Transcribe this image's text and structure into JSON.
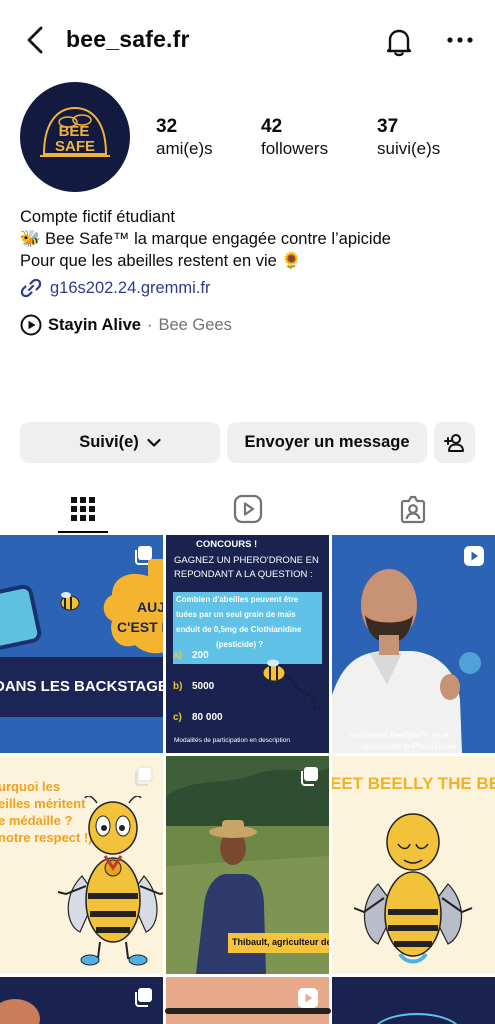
{
  "header": {
    "username": "bee_safe.fr",
    "back_icon": "chevron-left-icon",
    "bell_icon": "bell-icon",
    "more_icon": "more-horizontal-icon"
  },
  "profile": {
    "avatar_text_top": "BEE",
    "avatar_text_bottom": "SAFE",
    "stats": [
      {
        "value": "32",
        "label": "ami(e)s"
      },
      {
        "value": "42",
        "label": "followers"
      },
      {
        "value": "37",
        "label": "suivi(e)s"
      }
    ],
    "bio": [
      "Compte fictif étudiant",
      "🐝 Bee Safe™ la marque engagée contre l’apicide",
      "Pour que les abeilles restent en vie 🌻"
    ],
    "link": "g16s202.24.gremmi.fr",
    "music_title": "Stayin Alive",
    "music_separator": "·",
    "music_artist": "Bee Gees"
  },
  "actions": {
    "follow_label": "Suivi(e)",
    "message_label": "Envoyer un message",
    "add_user_icon": "add-user-icon"
  },
  "tabs": [
    {
      "name": "posts",
      "icon": "grid-icon",
      "active": true
    },
    {
      "name": "reels",
      "icon": "reels-icon",
      "active": false
    },
    {
      "name": "tagged",
      "icon": "tagged-icon",
      "active": false
    }
  ],
  "posts": {
    "p1_line1": "AUJ",
    "p1_line2": "C'EST M",
    "p1_banner": "DANS LES BACKSTAGE",
    "p2_title": "CONCOURS !",
    "p2_q1": "GAGNEZ UN PHERO'DRONE EN",
    "p2_q2": "REPONDANT A LA QUESTION :",
    "p2_box1": "Combien d'abeilles peuvent être",
    "p2_box2": "tuées par un seul grain de maïs",
    "p2_box3": "enduit de 0,5mg de Clothianidine",
    "p2_box4": "(pesticide) ?",
    "p2_opt_a_letter": "a)",
    "p2_opt_a": "200",
    "p2_opt_b_letter": "b)",
    "p2_opt_b": "5000",
    "p2_opt_c_letter": "c)",
    "p2_opt_c": "80 000",
    "p2_footer": "Modalités de participation en description",
    "p3_caption1": "en fondant BeeSafe™, et en",
    "p3_caption2": "conservant le Phéro'Drone",
    "p4_line1": "urquoi les",
    "p4_line2": "eilles méritent",
    "p4_line3": "e médaille ?",
    "p4_line4": "notre respect !)",
    "p5_caption": "Thibault, agriculteur depuis",
    "p6_title": "EET BEELLY THE BE"
  },
  "colors": {
    "accent_link": "#2a3d8f",
    "button_bg": "#efefef",
    "navy": "#121b3f",
    "bee_yellow": "#f6c33a",
    "post_blue": "#2c63b4"
  }
}
